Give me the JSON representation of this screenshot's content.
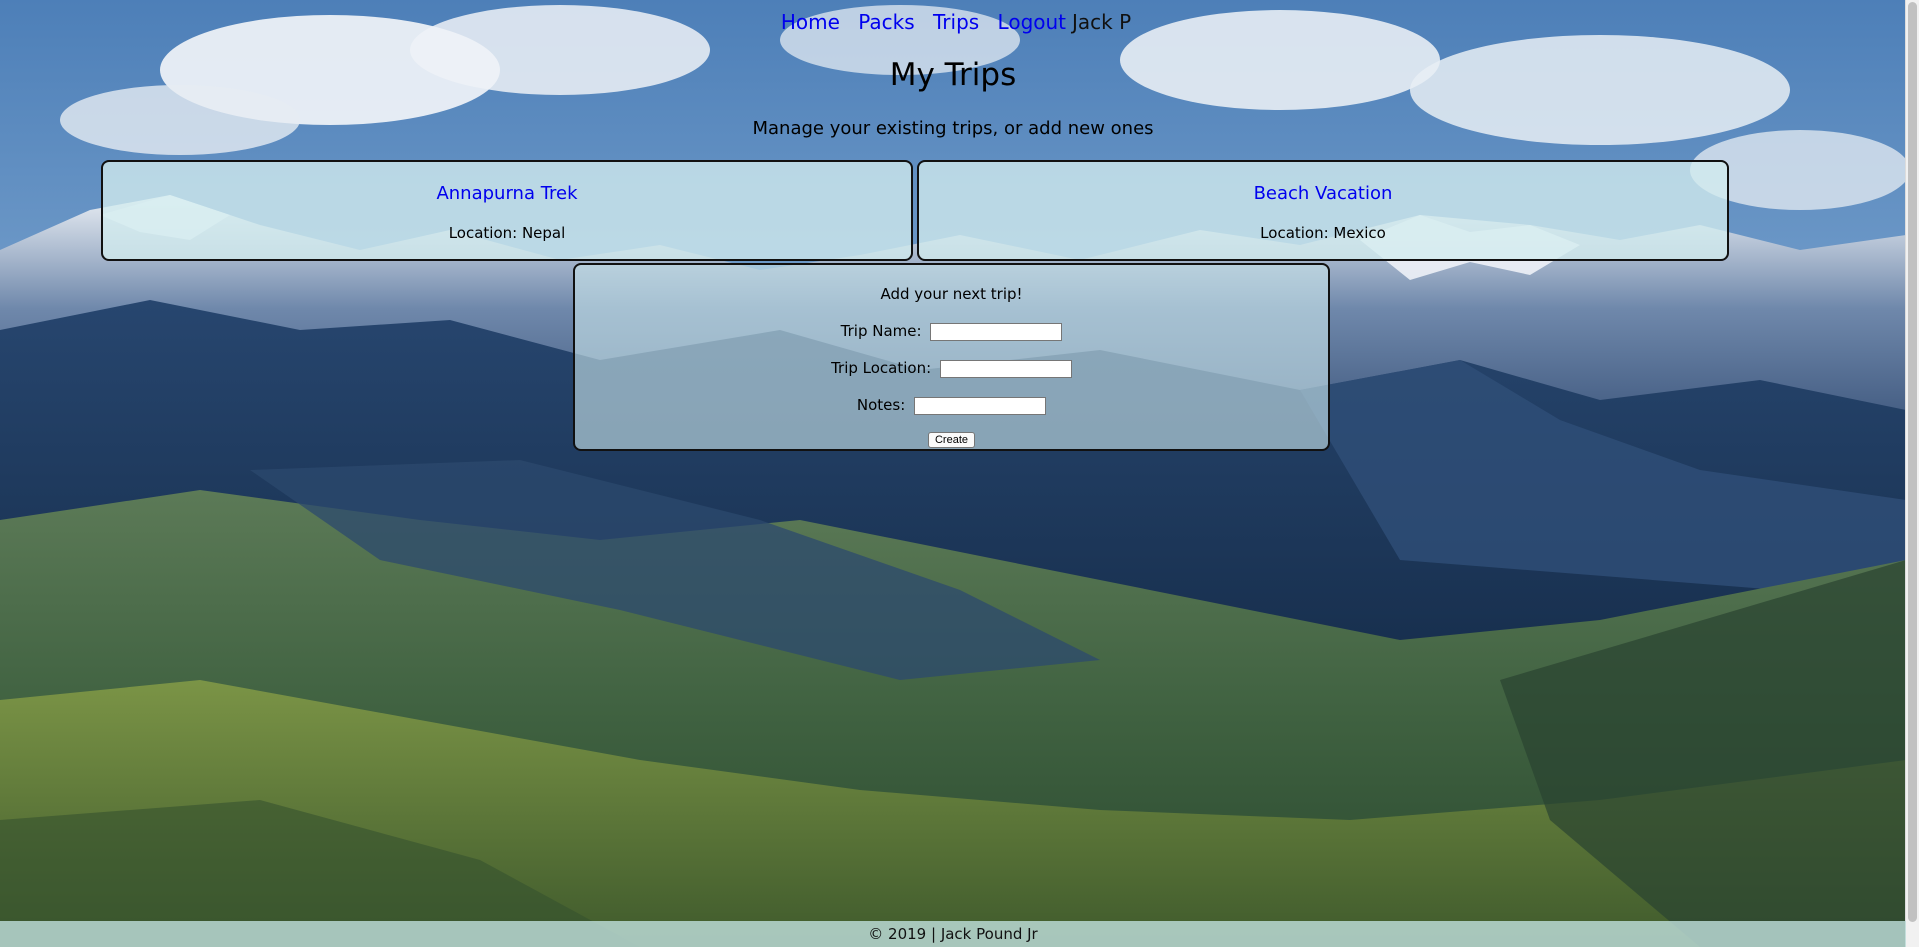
{
  "nav": {
    "home": "Home",
    "packs": "Packs",
    "trips": "Trips",
    "logout": "Logout",
    "user": "Jack P"
  },
  "header": {
    "title": "My Trips",
    "subtitle": "Manage your existing trips, or add new ones"
  },
  "trips": [
    {
      "name": "Annapurna Trek",
      "location": "Location: Nepal"
    },
    {
      "name": "Beach Vacation",
      "location": "Location: Mexico"
    }
  ],
  "form": {
    "title": "Add your next trip!",
    "trip_name_label": "Trip Name:",
    "trip_name_value": "",
    "trip_location_label": "Trip Location:",
    "trip_location_value": "",
    "notes_label": "Notes:",
    "notes_value": "",
    "create_label": "Create"
  },
  "footer": {
    "text": "© 2019 | Jack Pound Jr"
  },
  "colors": {
    "link": "#0000ee",
    "card_bg": "#d2ecee",
    "footer_bg": "#bededa"
  }
}
